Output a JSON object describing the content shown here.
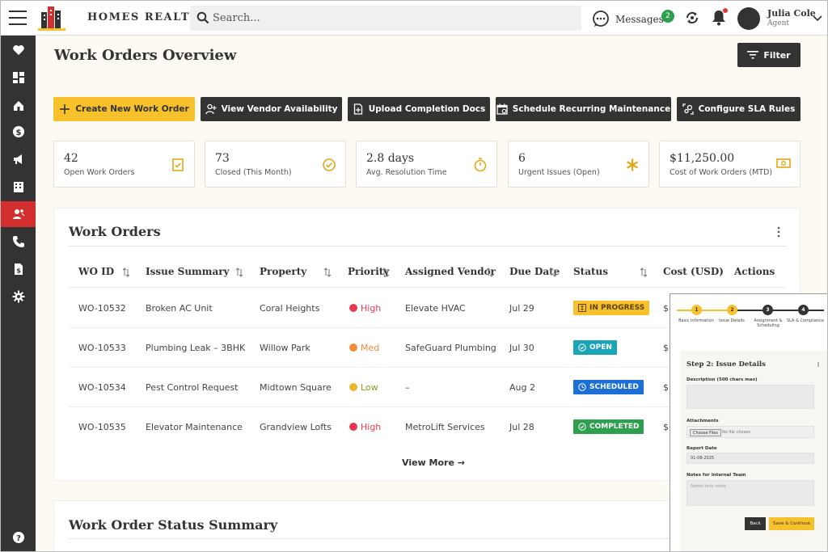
{
  "header": {
    "brand": "HOMES REALTY",
    "search_placeholder": "Search...",
    "messages_label": "Messages",
    "messages_count": "2",
    "user_name": "Julia Cole",
    "user_role": "Agent"
  },
  "sidebar": {
    "items": [
      "heart-icon",
      "dashboard-icon",
      "property-icon",
      "dollar-icon",
      "megaphone-icon",
      "building-icon",
      "users-icon",
      "phone-icon",
      "document-dollar-icon",
      "gear-icon",
      "help-icon"
    ],
    "active": "users-icon"
  },
  "page": {
    "title": "Work Orders Overview",
    "filter_label": "Filter"
  },
  "actions": [
    {
      "label": "Create New Work Order"
    },
    {
      "label": "View Vendor Availability"
    },
    {
      "label": "Upload Completion Docs"
    },
    {
      "label": "Schedule Recurring Maintenance"
    },
    {
      "label": "Configure SLA Rules"
    }
  ],
  "stats": [
    {
      "value": "42",
      "label": "Open Work Orders"
    },
    {
      "value": "73",
      "label": "Closed (This Month)"
    },
    {
      "value": "2.8 days",
      "label": "Avg. Resolution Time"
    },
    {
      "value": "6",
      "label": "Urgent Issues (Open)"
    },
    {
      "value": "$11,250.00",
      "label": "Cost of Work Orders (MTD)"
    }
  ],
  "table": {
    "title": "Work Orders",
    "headers": [
      "WO ID",
      "Issue Summary",
      "Property",
      "Priority",
      "Assigned Vendor",
      "Due Date",
      "Status",
      "Cost (USD)",
      "Actions"
    ],
    "rows": [
      {
        "id": "WO-10532",
        "issue": "Broken AC Unit",
        "property": "Coral Heights",
        "priority": "High",
        "vendor": "Elevate HVAC",
        "due": "Jul 29",
        "status": "IN PROGRESS",
        "cost": "$"
      },
      {
        "id": "WO-10533",
        "issue": "Plumbing Leak – 3BHK",
        "property": "Willow Park",
        "priority": "Med",
        "vendor": "SafeGuard Plumbing",
        "due": "Jul 30",
        "status": "OPEN",
        "cost": "$"
      },
      {
        "id": "WO-10534",
        "issue": "Pest Control Request",
        "property": "Midtown Square",
        "priority": "Low",
        "vendor": "–",
        "due": "Aug 2",
        "status": "SCHEDULED",
        "cost": "$"
      },
      {
        "id": "WO-10535",
        "issue": "Elevator Maintenance",
        "property": "Grandview Lofts",
        "priority": "High",
        "vendor": "MetroLift Services",
        "due": "Jul 28",
        "status": "COMPLETED",
        "cost": "$"
      }
    ],
    "view_more": "View More →"
  },
  "summary": {
    "title": "Work Order Status Summary"
  },
  "colors": {
    "accent": "#f7c12c",
    "dark": "#333333",
    "sidebar_active": "#d32f2f",
    "priority_high": "#e53950",
    "priority_med": "#f28b3c",
    "priority_low": "#e8b82a",
    "status_in_progress": "#f7c12c",
    "status_open": "#1ba3b8",
    "status_scheduled": "#1d6fd8",
    "status_completed": "#2e9e4f"
  },
  "wizard": {
    "steps": [
      {
        "num": "1",
        "label": "Basic Information"
      },
      {
        "num": "2",
        "label": "Issue Details"
      },
      {
        "num": "3",
        "label": "Assignment & Scheduling"
      },
      {
        "num": "4",
        "label": "SLA & Compliance"
      }
    ],
    "title": "Step 2: Issue Details",
    "description_label": "Description (500 chars max)",
    "attachments_label": "Attachments",
    "choose_files": "Choose Files",
    "no_file": "No file chosen",
    "report_date_label": "Report Date",
    "report_date_value": "01-08-2025",
    "notes_label": "Notes for Internal Team",
    "notes_placeholder": "Admin-only notes",
    "back_label": "Back",
    "save_label": "Save & Continue"
  }
}
